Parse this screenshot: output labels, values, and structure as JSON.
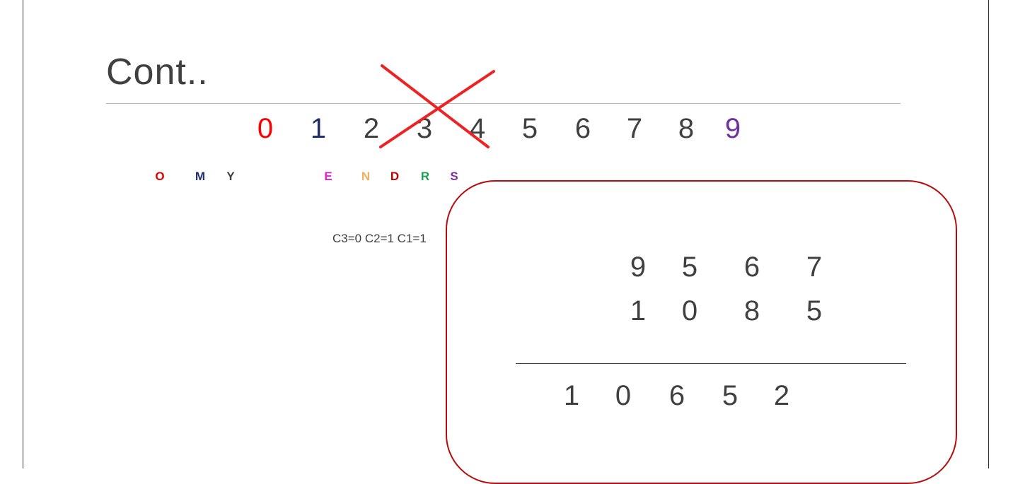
{
  "slide": {
    "title": "Cont..",
    "digits": [
      {
        "text": "0",
        "color": "#ff0000"
      },
      {
        "text": "1",
        "color": "#1f2f6e"
      },
      {
        "text": "2",
        "color": "#404040"
      },
      {
        "text": "3",
        "color": "#404040"
      },
      {
        "text": "4",
        "color": "#404040"
      },
      {
        "text": "5",
        "color": "#404040"
      },
      {
        "text": "6",
        "color": "#404040"
      },
      {
        "text": "7",
        "color": "#404040"
      },
      {
        "text": "8",
        "color": "#404040"
      },
      {
        "text": "9",
        "color": "#7030a0"
      }
    ],
    "letters": [
      {
        "text": "O",
        "color": "#e00000"
      },
      {
        "text": "M",
        "color": "#1f2f6e"
      },
      {
        "text": "Y",
        "color": "#404040"
      },
      {
        "text": "E",
        "color": "#e020d0"
      },
      {
        "text": "N",
        "color": "#f0b060"
      },
      {
        "text": "D",
        "color": "#c00000"
      },
      {
        "text": "R",
        "color": "#20a050"
      },
      {
        "text": "S",
        "color": "#8030a0"
      }
    ],
    "carries": "C3=0 C2=1 C1=1",
    "addition": {
      "row1": [
        "9",
        "5",
        "6",
        "7"
      ],
      "row2": [
        "1",
        "0",
        "8",
        "5"
      ],
      "result": [
        "1",
        "0",
        "6",
        "5",
        "2"
      ]
    },
    "colors": {
      "box_border": "#b80c0c",
      "cross": "#ee2222",
      "text": "#404040"
    }
  }
}
